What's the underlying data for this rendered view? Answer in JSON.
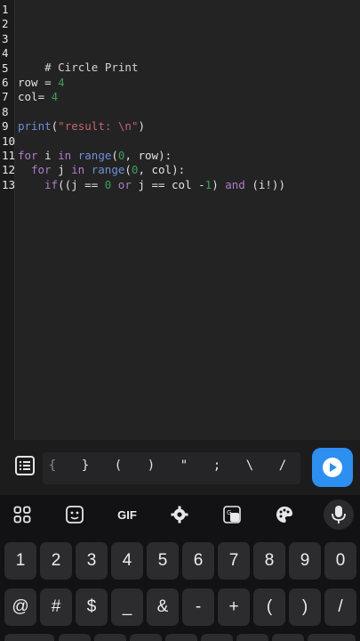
{
  "editor": {
    "line_numbers": [
      "1",
      "2",
      "3",
      "4",
      "5",
      "6",
      "7",
      "8",
      "9",
      "10",
      "11",
      "12",
      "13"
    ],
    "lines": [
      {
        "comment": "# Circle Print"
      },
      {
        "var": "row",
        "op": " = ",
        "num": "4"
      },
      {
        "var": "col",
        "op": "= ",
        "num": "4"
      },
      {
        "fn": "print",
        "p1": "(",
        "str": "\"result: \\n\"",
        "p2": ")"
      },
      {
        "kw1": "for",
        "a": " i ",
        "kw2": "in",
        "b": " ",
        "fn": "range",
        "c": "(",
        "num": "0",
        "d": ", row):"
      },
      {
        "kw1": "for",
        "a": " j ",
        "kw2": "in",
        "b": " ",
        "fn": "range",
        "c": "(",
        "num": "0",
        "d": ", col):"
      },
      {
        "kw1": "if",
        "a": "((j == ",
        "num1": "0",
        "kw2": " or ",
        "b": "j == col -",
        "num2": "1",
        "c": ") ",
        "kw3": "and",
        "d": " (i!))"
      }
    ]
  },
  "symbol_bar": {
    "symbols": [
      "{",
      "}",
      "(",
      ")",
      "\"",
      ";",
      "\\",
      "/"
    ],
    "run_label": "run"
  },
  "keyboard": {
    "toolbar": [
      "apps-grid",
      "sticker",
      "GIF",
      "settings",
      "translate",
      "palette",
      "mic"
    ],
    "gif_label": "GIF",
    "row_numbers": [
      "1",
      "2",
      "3",
      "4",
      "5",
      "6",
      "7",
      "8",
      "9",
      "0"
    ],
    "row_symbols": [
      "@",
      "#",
      "$",
      "_",
      "&",
      "-",
      "+",
      "(",
      ")",
      "/"
    ]
  }
}
